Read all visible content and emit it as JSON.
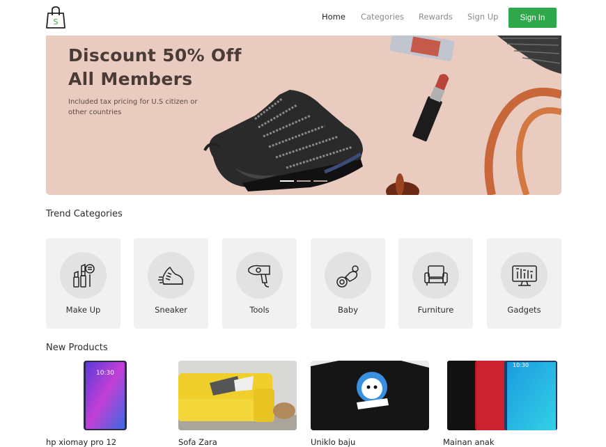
{
  "header": {
    "logo_letter": "S",
    "nav": [
      "Home",
      "Categories",
      "Rewards",
      "Sign Up"
    ],
    "active": "Home",
    "signin_label": "Sign In",
    "accent": "#2ea84a"
  },
  "hero": {
    "title": "Discount 50% Off\nAll Members",
    "subtitle": "Included tax pricing for U.S citizen or other countries",
    "background": "#eacbc0",
    "slides": 3,
    "active_slide": 1
  },
  "trend": {
    "title": "Trend Categories",
    "categories": [
      {
        "label": "Make Up",
        "icon": "makeup-icon"
      },
      {
        "label": "Sneaker",
        "icon": "sneaker-icon"
      },
      {
        "label": "Tools",
        "icon": "hairdryer-icon"
      },
      {
        "label": "Baby",
        "icon": "pacifier-icon"
      },
      {
        "label": "Furniture",
        "icon": "armchair-icon"
      },
      {
        "label": "Gadgets",
        "icon": "monitor-icon"
      }
    ]
  },
  "products": {
    "title": "New Products",
    "items": [
      {
        "name": "hp xiomay pro 12"
      },
      {
        "name": "Sofa Zara"
      },
      {
        "name": "Uniklo baju"
      },
      {
        "name": "Mainan anak"
      }
    ]
  }
}
